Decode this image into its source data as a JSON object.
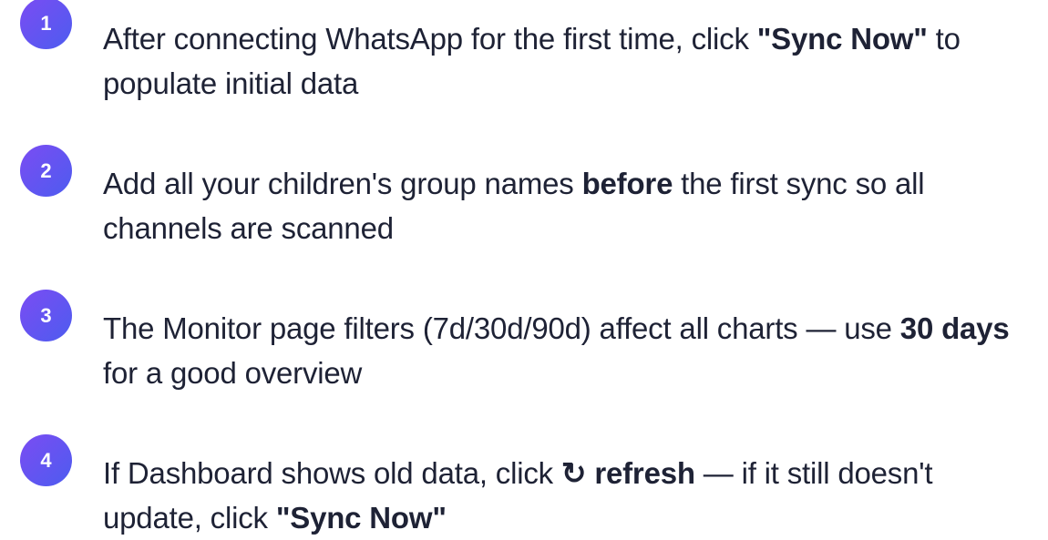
{
  "tips": [
    {
      "number": "1",
      "part1": "After connecting WhatsApp for the first time, click ",
      "bold1": "\"Sync Now\"",
      "part2": " to populate initial data"
    },
    {
      "number": "2",
      "part1": "Add all your children's group names ",
      "bold1": "before",
      "part2": " the first sync so all channels are scanned"
    },
    {
      "number": "3",
      "part1": "The Monitor page filters (7d/30d/90d) affect all charts — use ",
      "bold1": "30 days",
      "part2": " for a good overview"
    },
    {
      "number": "4",
      "part1": "If Dashboard shows old data, click ",
      "icon": "↻",
      "icon_name": "refresh-icon",
      "bold1": " refresh",
      "part2": " — if it still doesn't update, click ",
      "bold2": "\"Sync Now\""
    }
  ]
}
